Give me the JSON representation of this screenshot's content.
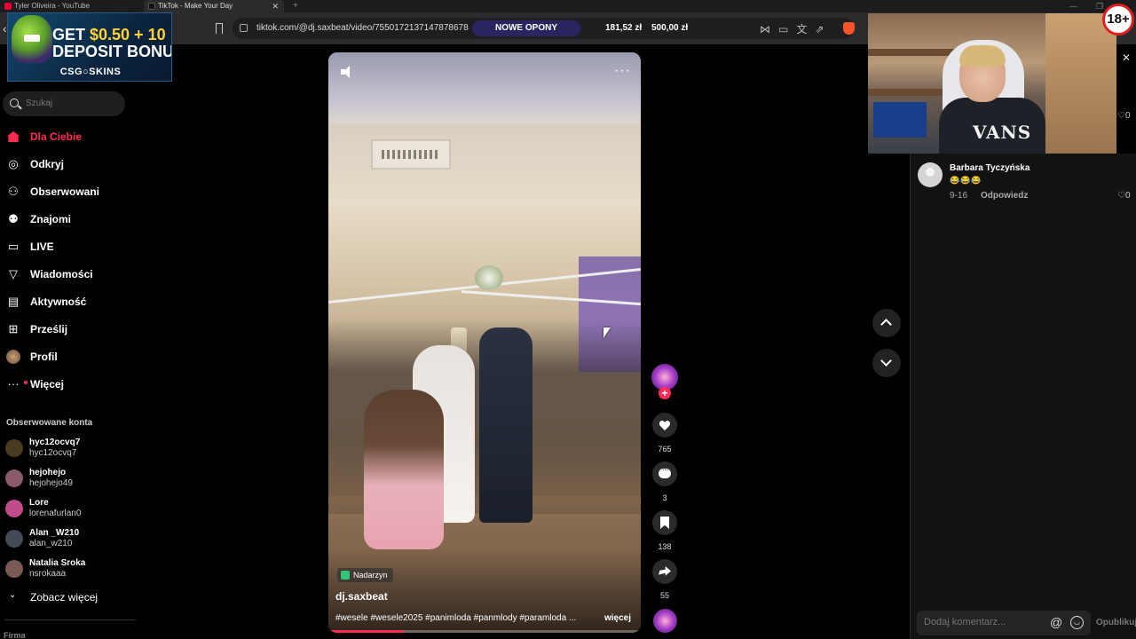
{
  "browser": {
    "tabs": [
      {
        "label": "Tyler Oliveira - YouTube"
      },
      {
        "label": "TikTok - Make Your Day"
      }
    ],
    "url": "tiktok.com/@dj.saxbeat/video/7550172137147878678",
    "promo_pill": "NOWE OPONY",
    "price_1": "181,52 zł",
    "price_2": "500,00 zł"
  },
  "ad": {
    "line1_prefix": "GET ",
    "line1_amount": "$0.50 + 10",
    "line2": "DEPOSIT BONU",
    "brand": "CSG○SKINS"
  },
  "sidebar": {
    "search_placeholder": "Szukaj",
    "nav": [
      {
        "label": "Dla Ciebie",
        "icon": "home-icon",
        "active": true
      },
      {
        "label": "Odkryj",
        "icon": "compass-icon"
      },
      {
        "label": "Obserwowani",
        "icon": "user-plus-icon"
      },
      {
        "label": "Znajomi",
        "icon": "friends-icon"
      },
      {
        "label": "LIVE",
        "icon": "live-icon"
      },
      {
        "label": "Wiadomości",
        "icon": "send-icon"
      },
      {
        "label": "Aktywność",
        "icon": "inbox-icon"
      },
      {
        "label": "Prześlij",
        "icon": "upload-icon"
      },
      {
        "label": "Profil",
        "icon": "profile-avatar"
      },
      {
        "label": "Więcej",
        "icon": "more-icon"
      }
    ],
    "followed_heading": "Obserwowane konta",
    "followed": [
      {
        "name": "hyc12ocvq7",
        "handle": "hyc12ocvq7",
        "avatar_color": "#4a3a22"
      },
      {
        "name": "hejohejo",
        "handle": "hejohejo49",
        "avatar_color": "#8a5a6a"
      },
      {
        "name": "Lore",
        "handle": "lorenafurlan0",
        "avatar_color": "#c04a8a"
      },
      {
        "name": "Alan _W210",
        "handle": "alan_w210",
        "avatar_color": "#444a55"
      },
      {
        "name": "Natalia Sroka",
        "handle": "nsrokaaa",
        "avatar_color": "#7a5a55"
      }
    ],
    "see_more": "Zobacz więcej",
    "footer": "Firma"
  },
  "video": {
    "location": "Nadarzyn",
    "author": "dj.saxbeat",
    "description": "#wesele #wesele2025 #panimloda #panmlody #paramloda ...",
    "more_label": "więcej",
    "progress": 0.24
  },
  "actions": {
    "likes": "765",
    "comments": "3",
    "saves": "138",
    "shares": "55"
  },
  "comments_panel": {
    "comment": {
      "author": "Barbara Tyczyńska",
      "text": "😂😂😂",
      "date": "9-16",
      "reply_label": "Odpowiedz",
      "likes": "0"
    },
    "top_like_count": "0",
    "input_placeholder": "Dodaj komentarz...",
    "post_label": "Opublikuj"
  },
  "stream": {
    "age_badge": "18+",
    "shirt_logo": "VANS"
  },
  "colors": {
    "accent": "#fe2c55",
    "background": "#000000",
    "panel": "#121212"
  }
}
